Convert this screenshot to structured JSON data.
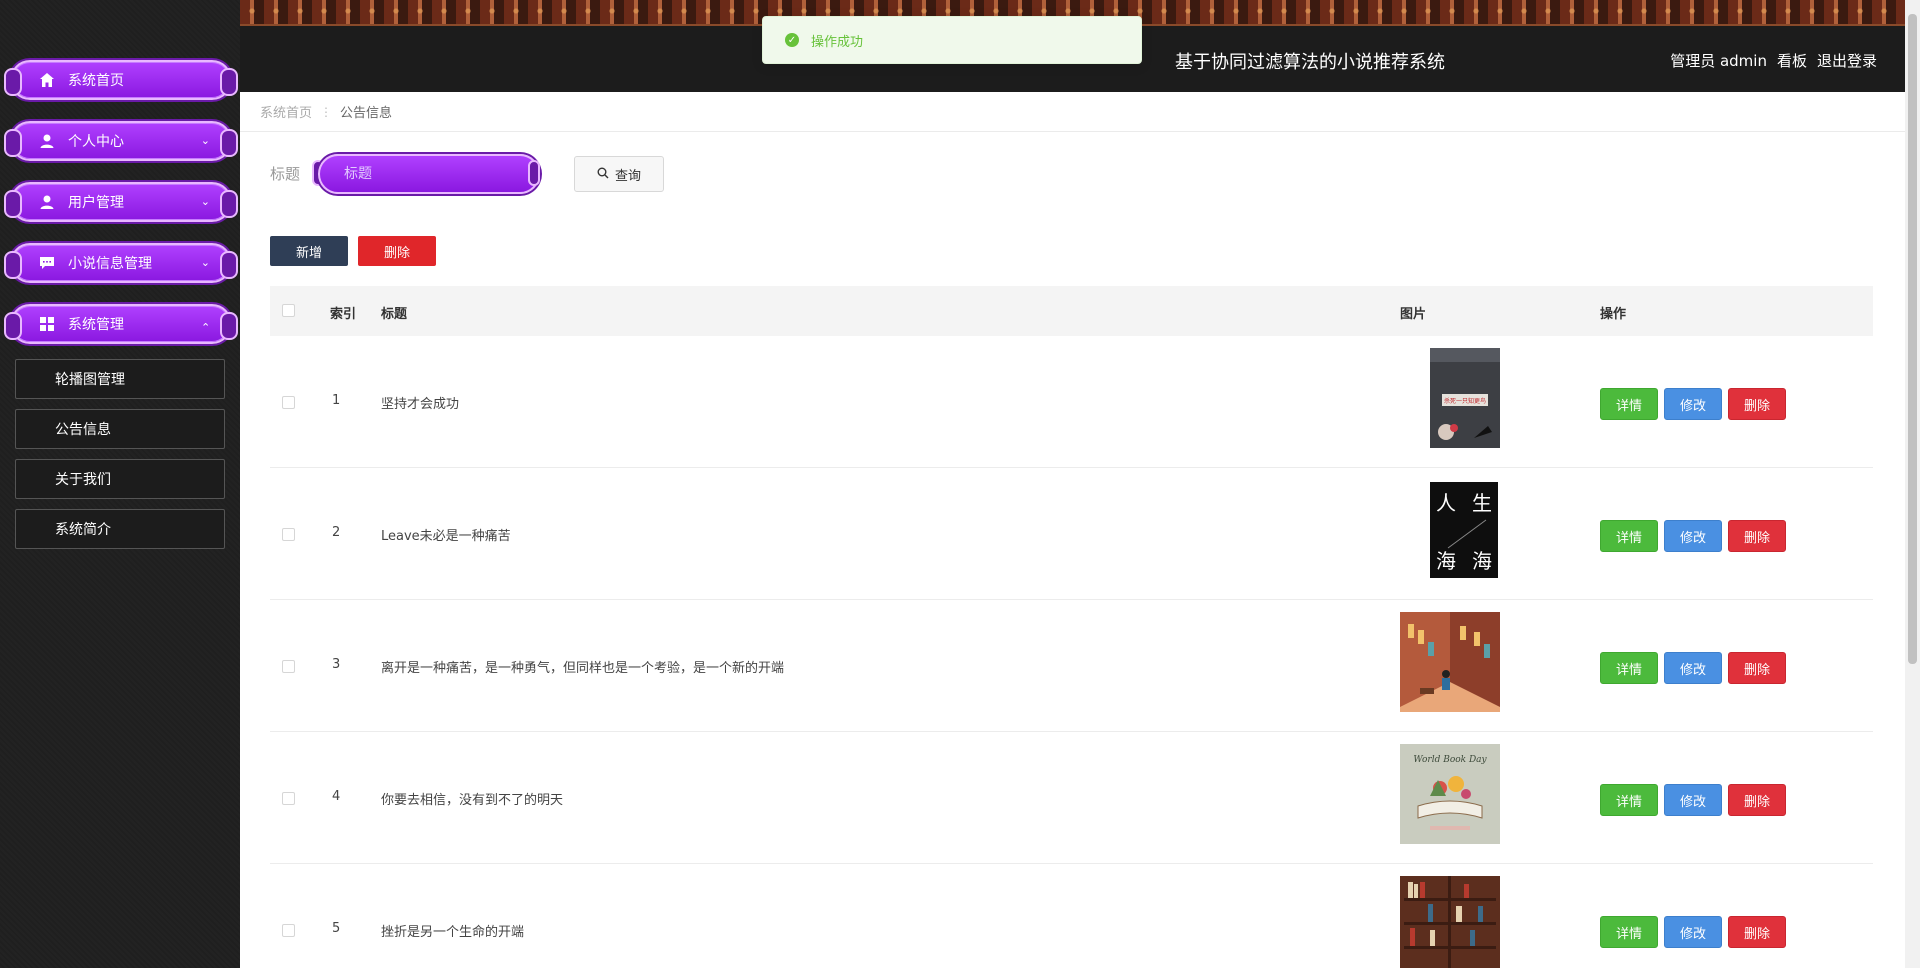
{
  "header": {
    "site_title": "基于协同过滤算法的小说推荐系统",
    "user_label": "管理员 admin",
    "board_link": "看板",
    "logout_link": "退出登录"
  },
  "toast": {
    "message": "操作成功"
  },
  "sidebar": {
    "menus": [
      {
        "label": "系统首页",
        "icon": "home-icon"
      },
      {
        "label": "个人中心",
        "icon": "user-icon"
      },
      {
        "label": "用户管理",
        "icon": "user-icon"
      },
      {
        "label": "小说信息管理",
        "icon": "chat-icon"
      },
      {
        "label": "系统管理",
        "icon": "grid-icon"
      }
    ],
    "submenus": [
      "轮播图管理",
      "公告信息",
      "关于我们",
      "系统简介"
    ]
  },
  "breadcrumb": {
    "home": "系统首页",
    "current": "公告信息"
  },
  "search": {
    "label": "标题",
    "placeholder": "标题",
    "button": "查询"
  },
  "actions": {
    "add": "新增",
    "delete": "删除"
  },
  "table": {
    "headers": {
      "index": "索引",
      "title": "标题",
      "image": "图片",
      "ops": "操作"
    },
    "ops": {
      "detail": "详情",
      "edit": "修改",
      "remove": "删除"
    },
    "rows": [
      {
        "index": "1",
        "title": "坚持才会成功"
      },
      {
        "index": "2",
        "title": "Leave未必是一种痛苦"
      },
      {
        "index": "3",
        "title": "离开是一种痛苦，是一种勇气，但同样也是一个考验，是一个新的开端"
      },
      {
        "index": "4",
        "title": "你要去相信，没有到不了的明天"
      },
      {
        "index": "5",
        "title": "挫折是另一个生命的开端"
      }
    ]
  },
  "book_covers": {
    "cover1_text": "杀死一只知更鸟",
    "cover2_chars": [
      "人",
      "生",
      "海",
      "海"
    ],
    "cover4_text": "World Book Day"
  }
}
